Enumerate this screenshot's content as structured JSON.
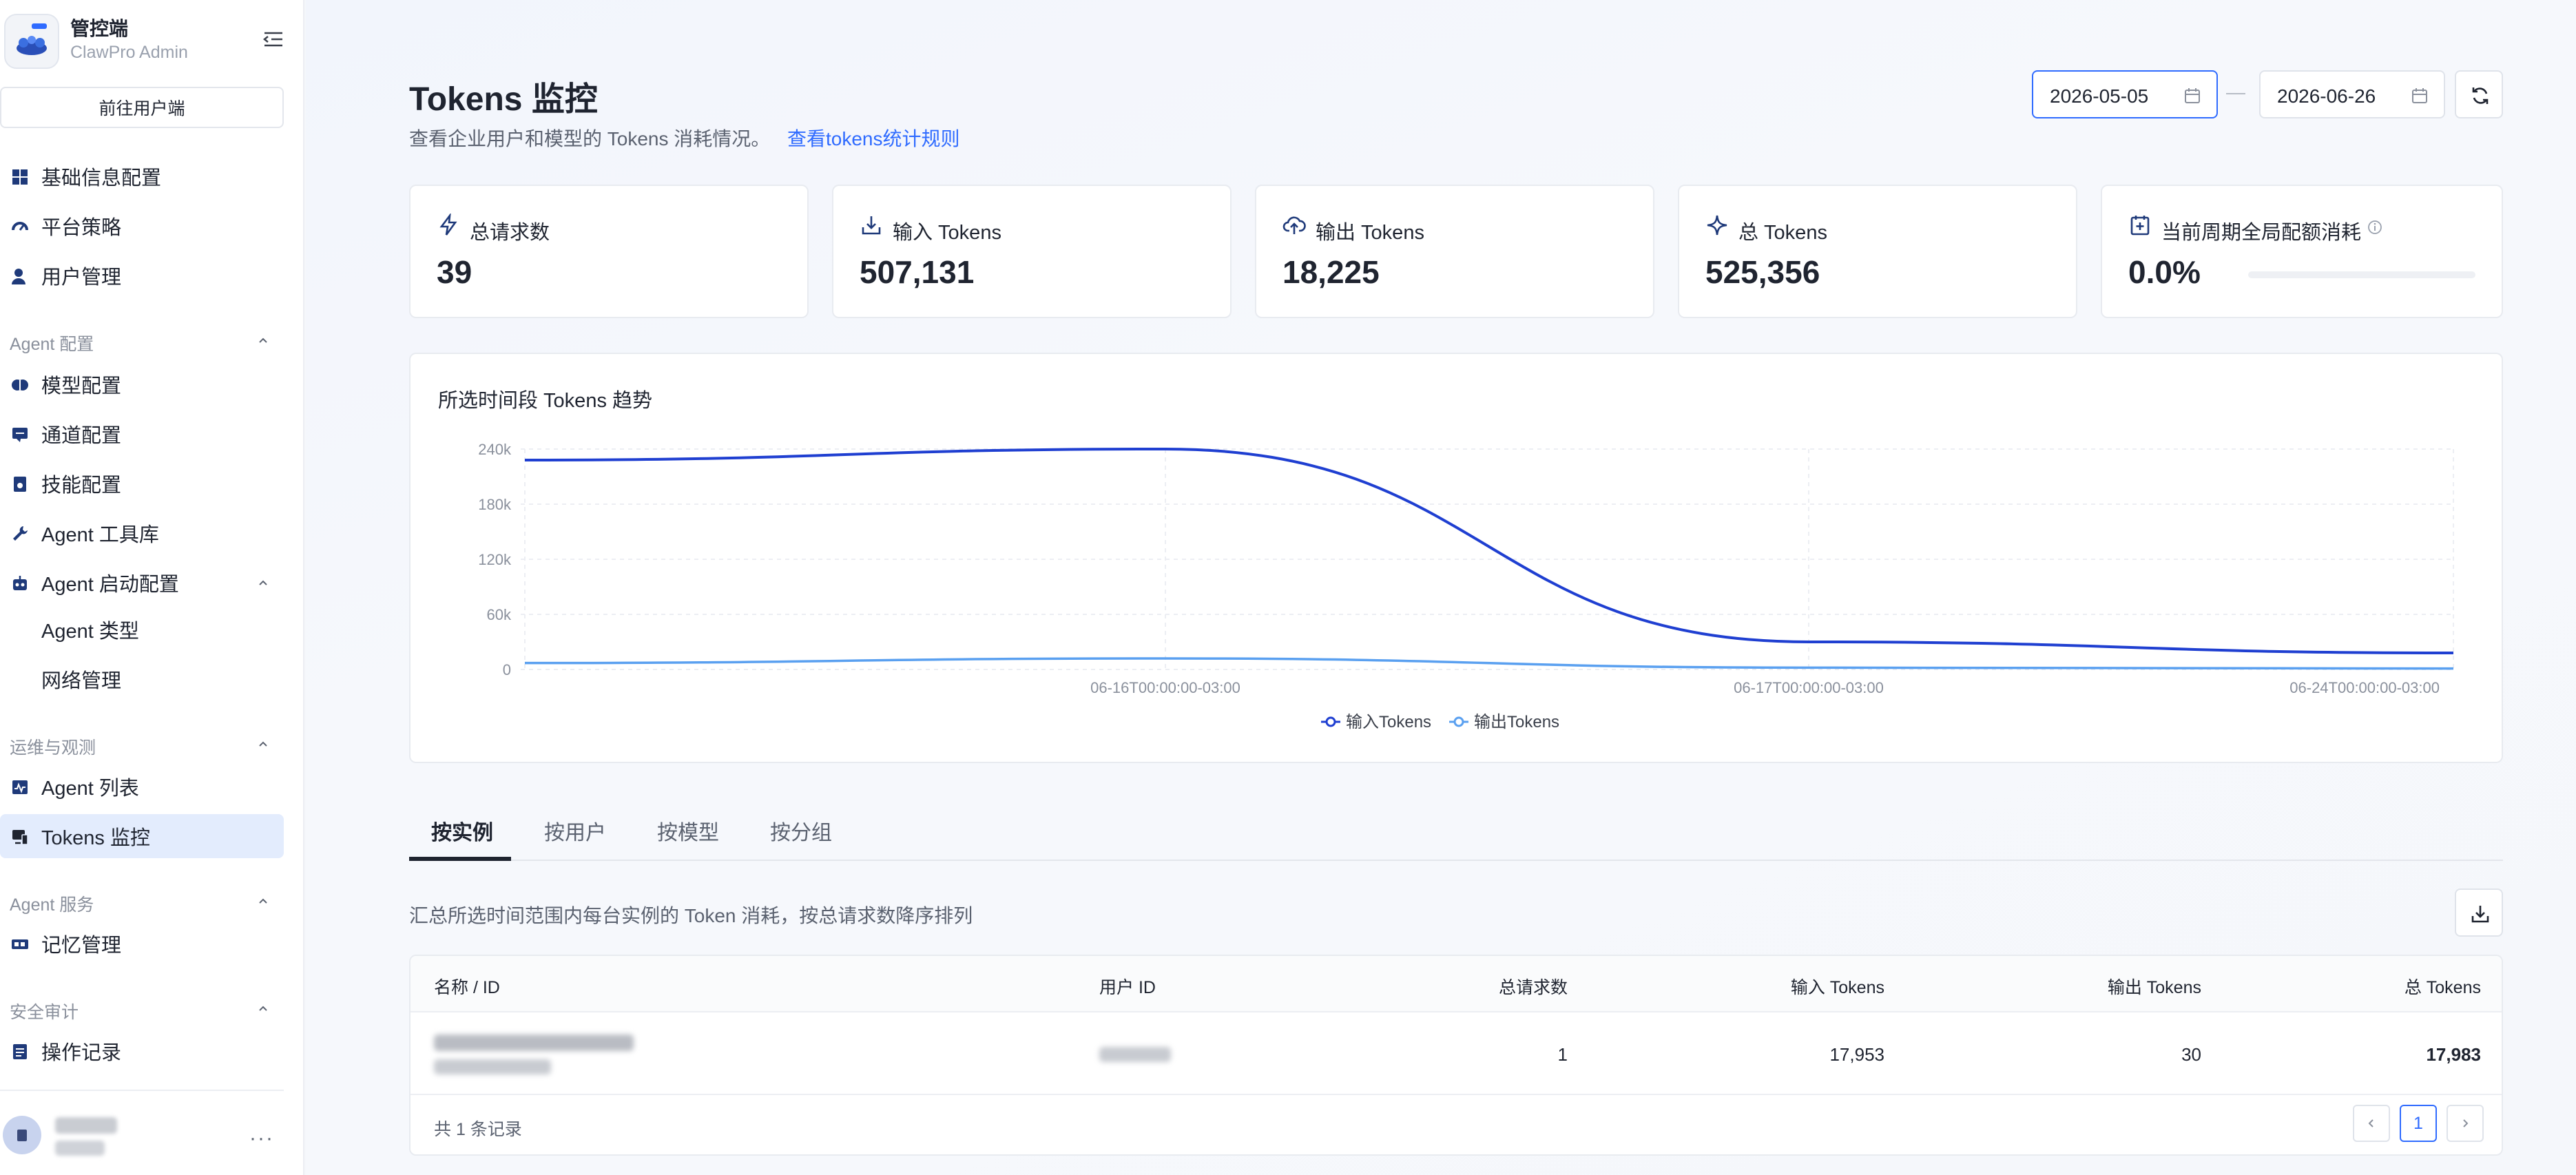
{
  "sidebar": {
    "brand_title": "管控端",
    "brand_subtitle": "ClawPro Admin",
    "goto_user_button": "前往用户端",
    "items_top": [
      {
        "label": "基础信息配置",
        "icon": "dashboard-icon"
      },
      {
        "label": "平台策略",
        "icon": "policy-icon"
      },
      {
        "label": "用户管理",
        "icon": "user-icon"
      }
    ],
    "section_agent_config": "Agent 配置",
    "items_agent_config": [
      {
        "label": "模型配置",
        "icon": "brain-icon"
      },
      {
        "label": "通道配置",
        "icon": "channel-icon"
      },
      {
        "label": "技能配置",
        "icon": "skill-icon"
      },
      {
        "label": "Agent 工具库",
        "icon": "wrench-icon"
      },
      {
        "label": "Agent 启动配置",
        "icon": "robot-icon"
      }
    ],
    "items_agent_launch_sub": [
      {
        "label": "Agent 类型"
      },
      {
        "label": "网络管理"
      }
    ],
    "section_ops": "运维与观测",
    "items_ops": [
      {
        "label": "Agent 列表",
        "icon": "activity-icon"
      },
      {
        "label": "Tokens 监控",
        "icon": "monitor-icon",
        "active": true
      }
    ],
    "section_agent_service": "Agent 服务",
    "items_agent_service": [
      {
        "label": "记忆管理",
        "icon": "memory-icon"
      }
    ],
    "section_audit": "安全审计",
    "items_audit": [
      {
        "label": "操作记录",
        "icon": "log-icon"
      }
    ]
  },
  "header": {
    "title": "Tokens 监控",
    "description": "查看企业用户和模型的 Tokens 消耗情况。",
    "rules_link": "查看tokens统计规则",
    "start_date": "2026-05-05",
    "end_date": "2026-06-26",
    "date_separator": "—"
  },
  "stats": [
    {
      "label": "总请求数",
      "value": "39",
      "icon": "lightning-icon"
    },
    {
      "label": "输入 Tokens",
      "value": "507,131",
      "icon": "input-icon"
    },
    {
      "label": "输出 Tokens",
      "value": "18,225",
      "icon": "upload-cloud-icon"
    },
    {
      "label": "总 Tokens",
      "value": "525,356",
      "icon": "sparkle-icon"
    },
    {
      "label": "当前周期全局配额消耗",
      "value": "0.0%",
      "icon": "quota-icon",
      "progress": 0.0
    }
  ],
  "chart_data": {
    "type": "line",
    "title": "所选时间段 Tokens 趋势",
    "x": [
      "",
      "06-16T00:00:00-03:00",
      "06-17T00:00:00-03:00",
      "06-24T00:00:00-03:00"
    ],
    "series": [
      {
        "name": "输入Tokens",
        "color": "#1f3fd1",
        "values": [
          228000,
          240000,
          30000,
          18000
        ]
      },
      {
        "name": "输出Tokens",
        "color": "#5aa0f0",
        "values": [
          7000,
          12000,
          2000,
          1000
        ]
      }
    ],
    "y_ticks": [
      "240k",
      "180k",
      "120k",
      "60k",
      "0"
    ],
    "ylim": [
      0,
      240000
    ],
    "grid": true,
    "legend": "bottom"
  },
  "tabs": [
    {
      "label": "按实例",
      "active": true
    },
    {
      "label": "按用户"
    },
    {
      "label": "按模型"
    },
    {
      "label": "按分组"
    }
  ],
  "table": {
    "description": "汇总所选时间范围内每台实例的 Token 消耗，按总请求数降序排列",
    "columns": [
      "名称 / ID",
      "用户 ID",
      "总请求数",
      "输入 Tokens",
      "输出 Tokens",
      "总 Tokens"
    ],
    "rows": [
      {
        "requests": "1",
        "input": "17,953",
        "output": "30",
        "total": "17,983"
      }
    ],
    "total_text": "共 1 条记录",
    "current_page": "1"
  },
  "colors": {
    "accent": "#2f6bff",
    "active_nav_bg": "#e3ecfd",
    "series_input": "#1f3fd1",
    "series_output": "#5aa0f0"
  }
}
